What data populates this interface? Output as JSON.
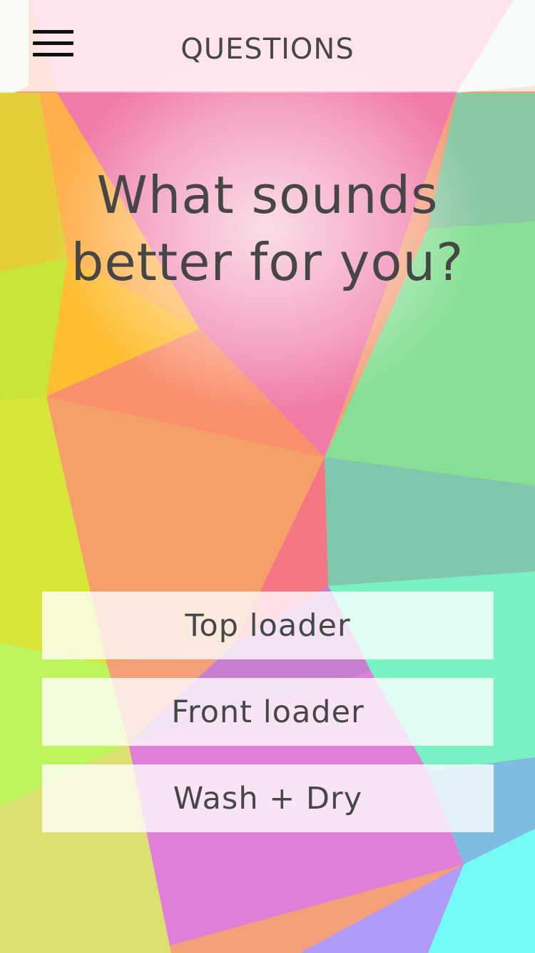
{
  "header": {
    "title": "QUESTIONS",
    "menu_icon": "hamburger-menu-icon"
  },
  "question": {
    "line1": "What sounds",
    "line2": "better for you?"
  },
  "answers": [
    {
      "label": "Top loader"
    },
    {
      "label": "Front loader"
    },
    {
      "label": "Wash + Dry"
    }
  ],
  "colors": {
    "text": "#474747",
    "header_bg": "#ffffff"
  }
}
